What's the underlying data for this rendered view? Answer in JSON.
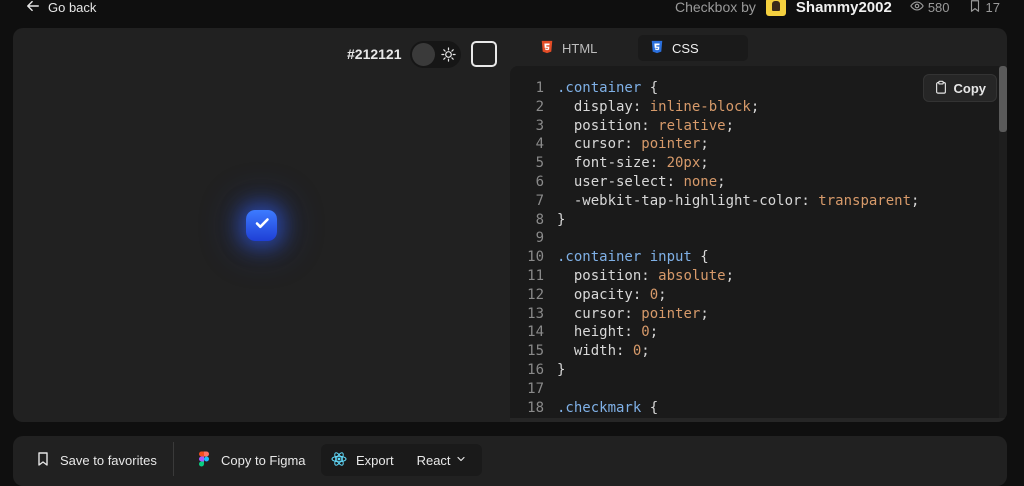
{
  "nav": {
    "back_label": "Go back"
  },
  "header": {
    "title": "Checkbox by",
    "author": "Shammy2002",
    "views": "580",
    "bookmarks": "17"
  },
  "preview": {
    "bg_color_label": "#212121",
    "checkbox_checked": true,
    "accent": "#2f5ae6"
  },
  "editor": {
    "tabs": [
      {
        "label": "HTML"
      },
      {
        "label": "CSS"
      }
    ],
    "active_tab": "CSS",
    "copy_label": "Copy",
    "lines": [
      {
        "n": "1",
        "parts": [
          [
            "sel",
            ".container"
          ],
          [
            "pun",
            " {"
          ]
        ]
      },
      {
        "n": "2",
        "parts": [
          [
            "prop",
            "  display: "
          ],
          [
            "val",
            "inline-block"
          ],
          [
            "pun",
            ";"
          ]
        ]
      },
      {
        "n": "3",
        "parts": [
          [
            "prop",
            "  position: "
          ],
          [
            "val",
            "relative"
          ],
          [
            "pun",
            ";"
          ]
        ]
      },
      {
        "n": "4",
        "parts": [
          [
            "prop",
            "  cursor: "
          ],
          [
            "val",
            "pointer"
          ],
          [
            "pun",
            ";"
          ]
        ]
      },
      {
        "n": "5",
        "parts": [
          [
            "prop",
            "  font-size: "
          ],
          [
            "val",
            "20px"
          ],
          [
            "pun",
            ";"
          ]
        ]
      },
      {
        "n": "6",
        "parts": [
          [
            "prop",
            "  user-select: "
          ],
          [
            "val",
            "none"
          ],
          [
            "pun",
            ";"
          ]
        ]
      },
      {
        "n": "7",
        "parts": [
          [
            "prop",
            "  -webkit-tap-highlight-color: "
          ],
          [
            "val",
            "transparent"
          ],
          [
            "pun",
            ";"
          ]
        ]
      },
      {
        "n": "8",
        "parts": [
          [
            "pun",
            "}"
          ]
        ]
      },
      {
        "n": "9",
        "parts": []
      },
      {
        "n": "10",
        "parts": [
          [
            "sel",
            ".container input"
          ],
          [
            "pun",
            " {"
          ]
        ]
      },
      {
        "n": "11",
        "parts": [
          [
            "prop",
            "  position: "
          ],
          [
            "val",
            "absolute"
          ],
          [
            "pun",
            ";"
          ]
        ]
      },
      {
        "n": "12",
        "parts": [
          [
            "prop",
            "  opacity: "
          ],
          [
            "val",
            "0"
          ],
          [
            "pun",
            ";"
          ]
        ]
      },
      {
        "n": "13",
        "parts": [
          [
            "prop",
            "  cursor: "
          ],
          [
            "val",
            "pointer"
          ],
          [
            "pun",
            ";"
          ]
        ]
      },
      {
        "n": "14",
        "parts": [
          [
            "prop",
            "  height: "
          ],
          [
            "val",
            "0"
          ],
          [
            "pun",
            ";"
          ]
        ]
      },
      {
        "n": "15",
        "parts": [
          [
            "prop",
            "  width: "
          ],
          [
            "val",
            "0"
          ],
          [
            "pun",
            ";"
          ]
        ]
      },
      {
        "n": "16",
        "parts": [
          [
            "pun",
            "}"
          ]
        ]
      },
      {
        "n": "17",
        "parts": []
      },
      {
        "n": "18",
        "parts": [
          [
            "sel",
            ".checkmark"
          ],
          [
            "pun",
            " {"
          ]
        ]
      }
    ]
  },
  "footer": {
    "favorites_label": "Save to favorites",
    "figma_label": "Copy to Figma",
    "export_label": "Export",
    "framework_label": "React"
  }
}
